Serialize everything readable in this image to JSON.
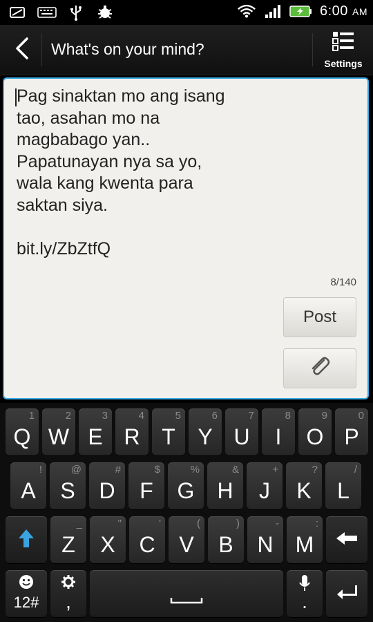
{
  "status_bar": {
    "time": "6:00",
    "ampm": "AM",
    "icons": [
      "sd-card-icon",
      "keyboard-icon",
      "usb-icon",
      "debug-icon",
      "wifi-icon",
      "signal-icon",
      "battery-charging-icon"
    ]
  },
  "action_bar": {
    "title": "What's on your mind?",
    "settings_label": "Settings"
  },
  "compose": {
    "text": "Pag sinaktan mo ang isang\ntao, asahan mo na\nmagbabago yan..\nPapatunayan nya sa yo,\nwala kang kwenta para\nsaktan siya.\n\nbit.ly/ZbZtfQ",
    "counter": "8/140",
    "post_label": "Post"
  },
  "colors": {
    "accent": "#39a7e3",
    "shift_arrow": "#3aa4e0"
  },
  "keyboard": {
    "row1": [
      {
        "main": "Q",
        "sub": "1"
      },
      {
        "main": "W",
        "sub": "2"
      },
      {
        "main": "E",
        "sub": "3"
      },
      {
        "main": "R",
        "sub": "4"
      },
      {
        "main": "T",
        "sub": "5"
      },
      {
        "main": "Y",
        "sub": "6"
      },
      {
        "main": "U",
        "sub": "7"
      },
      {
        "main": "I",
        "sub": "8"
      },
      {
        "main": "O",
        "sub": "9"
      },
      {
        "main": "P",
        "sub": "0"
      }
    ],
    "row2": [
      {
        "main": "A",
        "sub": "!"
      },
      {
        "main": "S",
        "sub": "@"
      },
      {
        "main": "D",
        "sub": "#"
      },
      {
        "main": "F",
        "sub": "$"
      },
      {
        "main": "G",
        "sub": "%"
      },
      {
        "main": "H",
        "sub": "&"
      },
      {
        "main": "J",
        "sub": "+"
      },
      {
        "main": "K",
        "sub": "?"
      },
      {
        "main": "L",
        "sub": "/"
      }
    ],
    "row3": [
      {
        "main": "Z",
        "sub": "_"
      },
      {
        "main": "X",
        "sub": "\""
      },
      {
        "main": "C",
        "sub": "'"
      },
      {
        "main": "V",
        "sub": "("
      },
      {
        "main": "B",
        "sub": ")"
      },
      {
        "main": "N",
        "sub": "-"
      },
      {
        "main": "M",
        "sub": ":"
      }
    ],
    "symbols_label": "12#",
    "comma": ",",
    "period": "."
  }
}
